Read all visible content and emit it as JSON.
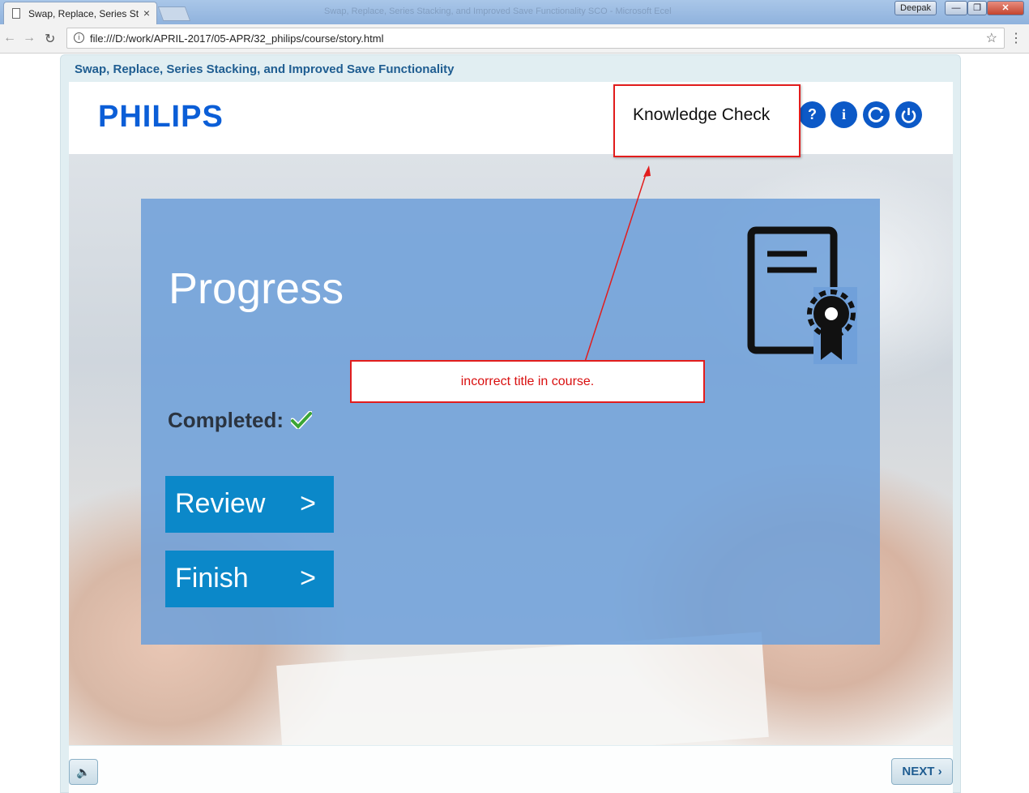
{
  "browser": {
    "tab_title": "Swap, Replace, Series Sta",
    "tab_close": "×",
    "window_title": "Swap, Replace, Series Stacking, and Improved Save Functionality SCO - Microsoft Ecel",
    "user": "Deepak",
    "url": "file:///D:/work/APRIL-2017/05-APR/32_philips/course/story.html"
  },
  "player": {
    "course_title": "Swap, Replace, Series Stacking, and Improved Save Functionality",
    "logo": "PHILIPS",
    "header_buttons": [
      "?",
      "i"
    ],
    "next_label": "NEXT",
    "next_chevron": "›"
  },
  "slide": {
    "title": "Progress",
    "completed_label": "Completed:",
    "buttons": [
      {
        "label": "Review",
        "arrow": ">"
      },
      {
        "label": "Finish",
        "arrow": ">"
      }
    ]
  },
  "annotations": {
    "callout_title": "Knowledge Check",
    "issue_note": "incorrect title in course."
  },
  "colors": {
    "brand_blue": "#0b5ed7",
    "panel_blue": "#70a0da",
    "cta_blue": "#0b88c9",
    "annotation_red": "#e21d1d"
  }
}
